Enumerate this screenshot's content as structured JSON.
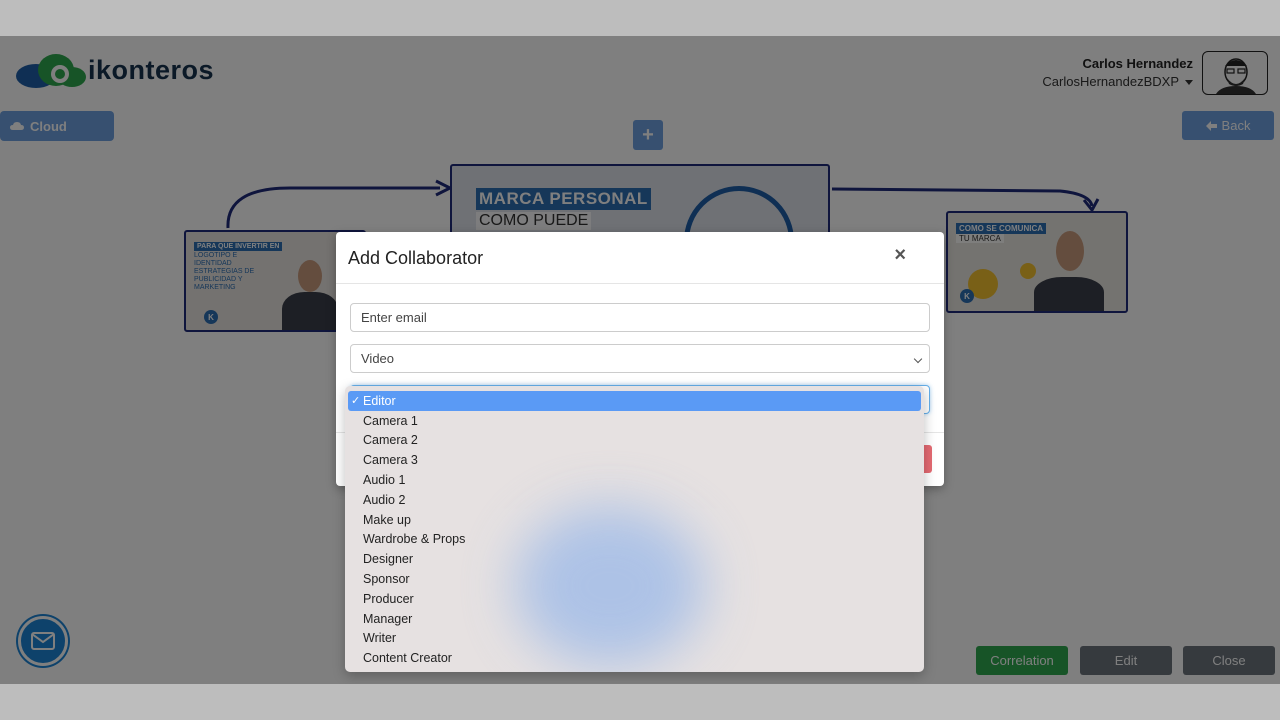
{
  "header": {
    "brand": "ikonteros",
    "user_name": "Carlos Hernandez",
    "user_handle": "CarlosHernandezBDXP"
  },
  "toolbar": {
    "cloud_label": "Cloud",
    "back_label": "Back",
    "plus_label": "+"
  },
  "canvas": {
    "center_thumb": {
      "line1": "MARCA PERSONAL",
      "line2": "COMO PUEDE"
    },
    "left_thumb": {
      "line1": "PARA QUE INVERTIR EN",
      "lines": [
        "LOGOTIPO E",
        "IDENTIDAD",
        "ESTRATEGIAS DE",
        "PUBLICIDAD Y",
        "MARKETING"
      ]
    },
    "right_thumb": {
      "line1": "COMO SE COMUNICA",
      "line2": "TU MARCA"
    },
    "badge": "K"
  },
  "bottom_buttons": {
    "correlation": "Correlation",
    "edit": "Edit",
    "close": "Close"
  },
  "modal": {
    "title": "Add Collaborator",
    "close_symbol": "×",
    "email_placeholder": "Enter email",
    "type_value": "Video",
    "role_options": [
      "Editor",
      "Camera 1",
      "Camera 2",
      "Camera 3",
      "Audio 1",
      "Audio 2",
      "Make up",
      "Wardrobe & Props",
      "Designer",
      "Sponsor",
      "Producer",
      "Manager",
      "Writer",
      "Content Creator"
    ],
    "selected_role": "Editor"
  },
  "colors": {
    "primary": "#6fa0e0",
    "success": "#2fa84f",
    "secondary": "#6c757d",
    "danger": "#dc3545",
    "selected_option": "#5a9af5"
  }
}
